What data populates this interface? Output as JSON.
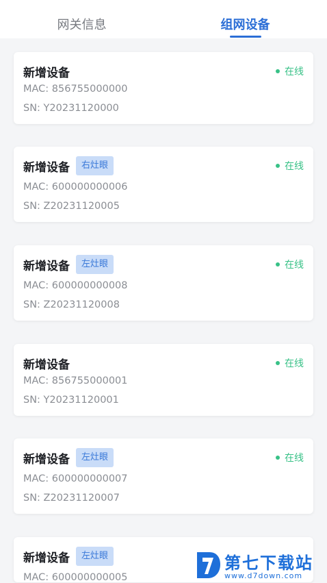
{
  "tabs": [
    {
      "label": "网关信息",
      "active": false
    },
    {
      "label": "组网设备",
      "active": true
    }
  ],
  "colors": {
    "accent": "#2b6ed6",
    "online": "#38c187",
    "tag_bg": "#c9dcf8",
    "tag_text": "#3a79d8",
    "page_bg": "#f4f5f7"
  },
  "devices": [
    {
      "name": "新增设备",
      "tag": "",
      "status": "在线",
      "mac": "MAC: 856755000000",
      "sn": "SN: Y20231120000"
    },
    {
      "name": "新增设备",
      "tag": "右灶眼",
      "status": "在线",
      "mac": "MAC: 600000000006",
      "sn": "SN: Z20231120005"
    },
    {
      "name": "新增设备",
      "tag": "左灶眼",
      "status": "在线",
      "mac": "MAC: 600000000008",
      "sn": "SN: Z20231120008"
    },
    {
      "name": "新增设备",
      "tag": "",
      "status": "在线",
      "mac": "MAC: 856755000001",
      "sn": "SN: Y20231120001"
    },
    {
      "name": "新增设备",
      "tag": "左灶眼",
      "status": "在线",
      "mac": "MAC: 600000000007",
      "sn": "SN: Z20231120007"
    },
    {
      "name": "新增设备",
      "tag": "左灶眼",
      "status": "",
      "mac": "MAC: 600000000005",
      "sn": ""
    }
  ],
  "watermark": {
    "title": "第七下载站",
    "url": "www.d7down.com",
    "logo_icon": "d7-logo-icon"
  }
}
